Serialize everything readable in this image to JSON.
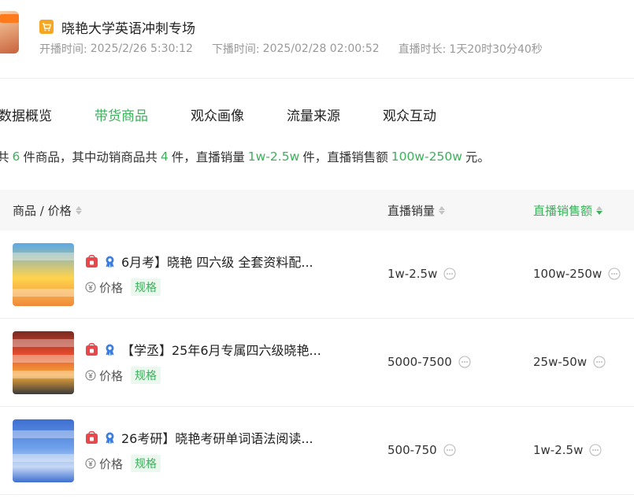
{
  "header": {
    "title": "晓艳大学英语冲刺专场",
    "start_label": "开播时间:",
    "start_value": "2025/2/26 5:30:12",
    "end_label": "下播时间:",
    "end_value": "2025/02/28 02:00:52",
    "duration_label": "直播时长:",
    "duration_value": "1天20时30分40秒"
  },
  "tabs": [
    {
      "label": "数据概览"
    },
    {
      "label": "带货商品",
      "active": true
    },
    {
      "label": "观众画像"
    },
    {
      "label": "流量来源"
    },
    {
      "label": "观众互动"
    }
  ],
  "summary": {
    "p1": "共",
    "total": "6",
    "p2": "件商品，其中动销商品共",
    "moving": "4",
    "p3": "件，直播销量",
    "sales": "1w-2.5w",
    "p4": "件，直播销售额",
    "revenue": "100w-250w",
    "p5": "元。"
  },
  "table": {
    "columns": [
      {
        "label": "商品 / 价格"
      },
      {
        "label": "直播销量"
      },
      {
        "label": "直播销售额",
        "active": true
      }
    ],
    "price_label": "价格",
    "spec_label": "规格",
    "rows": [
      {
        "name": "6月考】晓艳 四六级 全套资料配...",
        "sales": "1w-2.5w",
        "revenue": "100w-250w"
      },
      {
        "name": "【学丞】25年6月专属四六级晓艳...",
        "sales": "5000-7500",
        "revenue": "25w-50w"
      },
      {
        "name": "26考研】晓艳考研单词语法阅读...",
        "sales": "500-750",
        "revenue": "1w-2.5w"
      }
    ]
  },
  "colors": {
    "accent_green": "#3eb05c",
    "icon_red": "#e8474c",
    "icon_blue": "#3b7ee0",
    "cart_orange": "#f5a623"
  },
  "icons": {
    "cart": "shopping-cart-icon",
    "lock": "store-lock-icon",
    "badge": "award-badge-icon",
    "price": "yuan-circle-icon",
    "more": "ellipsis-circle-icon"
  }
}
